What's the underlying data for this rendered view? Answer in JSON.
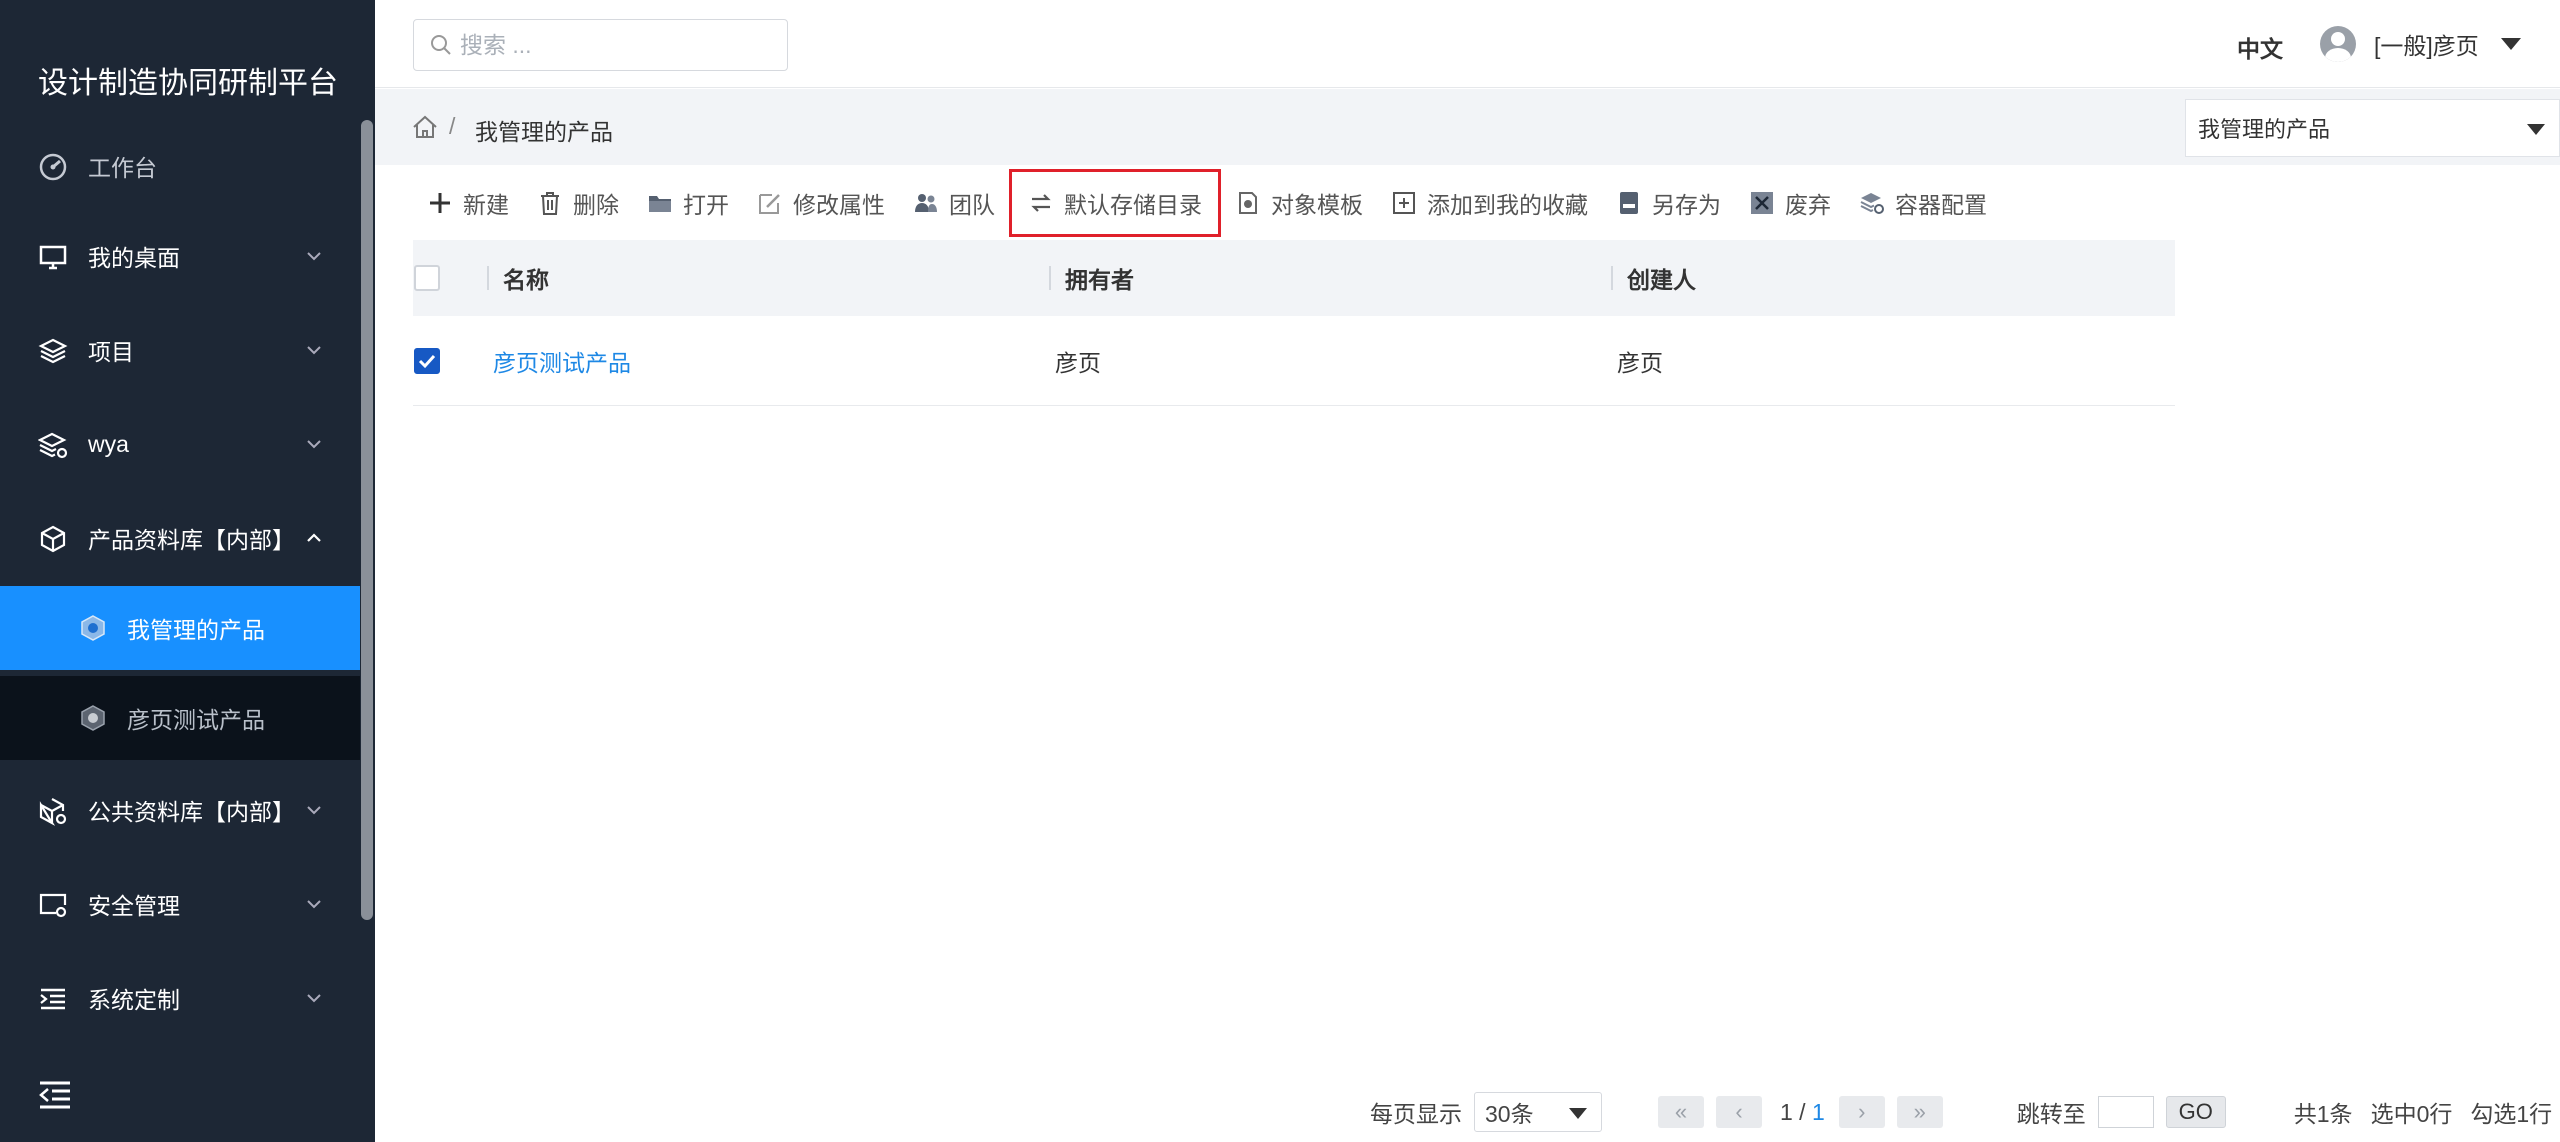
{
  "app": {
    "title": "设计制造协同研制平台"
  },
  "sidebar": {
    "items": [
      {
        "label": "工作台",
        "icon": "dashboard-icon"
      },
      {
        "label": "我的桌面",
        "icon": "monitor-icon"
      },
      {
        "label": "项目",
        "icon": "layers-icon"
      },
      {
        "label": "wya",
        "icon": "layers-gear-icon"
      },
      {
        "label": "产品资料库【内部】",
        "icon": "cube-icon"
      },
      {
        "label": "公共资料库【内部】",
        "icon": "cube-gear-icon"
      },
      {
        "label": "安全管理",
        "icon": "screen-gear-icon"
      },
      {
        "label": "系统定制",
        "icon": "list-indent-icon"
      }
    ],
    "subitems": [
      {
        "label": "我管理的产品",
        "icon": "product-icon",
        "active": true
      },
      {
        "label": "彦页测试产品",
        "icon": "product-icon",
        "active": false
      }
    ],
    "collapse_icon": "menu-collapse-icon"
  },
  "topbar": {
    "search_placeholder": "搜索 ...",
    "language": "中文",
    "user": "[一般]彦页"
  },
  "breadcrumb": {
    "current": "我管理的产品"
  },
  "context_select": {
    "value": "我管理的产品"
  },
  "toolbar": {
    "new": "新建",
    "delete": "删除",
    "open": "打开",
    "edit_props": "修改属性",
    "team": "团队",
    "default_dir": "默认存储目录",
    "obj_template": "对象模板",
    "add_fav": "添加到我的收藏",
    "save_as": "另存为",
    "discard": "废弃",
    "container_cfg": "容器配置"
  },
  "table": {
    "columns": [
      "名称",
      "拥有者",
      "创建人"
    ],
    "rows": [
      {
        "checked": true,
        "name": "彦页测试产品",
        "owner": "彦页",
        "creator": "彦页"
      }
    ]
  },
  "pager": {
    "per_page_label": "每页显示",
    "per_page_value": "30条",
    "page_current": "1",
    "page_sep": " / ",
    "page_total": "1",
    "jump_label": "跳转至",
    "go": "GO",
    "total": "共1条",
    "selected": "选中0行",
    "checked": "勾选1行"
  },
  "colors": {
    "sidebar_bg": "#1d2735",
    "active": "#1890ff",
    "link": "#1e88e5",
    "highlight": "#e0202a"
  }
}
